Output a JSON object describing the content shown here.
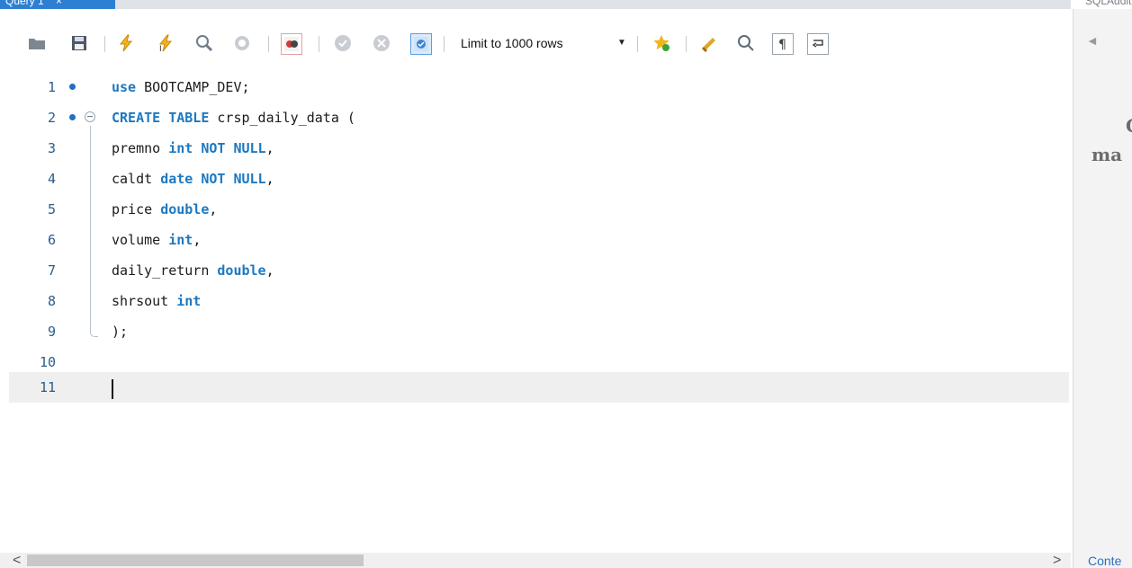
{
  "tab": {
    "title": "Query 1",
    "close": "×"
  },
  "right_tab": {
    "title": "SQLAdditions"
  },
  "toolbar": {
    "limit_label": "Limit to 1000 rows"
  },
  "editor": {
    "lines": [
      {
        "num": "1",
        "dot": true
      },
      {
        "num": "2",
        "dot": true,
        "fold": true
      },
      {
        "num": "3"
      },
      {
        "num": "4"
      },
      {
        "num": "5"
      },
      {
        "num": "6"
      },
      {
        "num": "7"
      },
      {
        "num": "8"
      },
      {
        "num": "9"
      },
      {
        "num": "10"
      },
      {
        "num": "11",
        "active": true
      }
    ],
    "code": {
      "l1_kw": "use",
      "l1_rest": " BOOTCAMP_DEV;",
      "l2_kw": "CREATE TABLE",
      "l2_rest": " crsp_daily_data (",
      "l3_id": "premno ",
      "l3_kw": "int NOT NULL",
      "l3_end": ",",
      "l4_id": "caldt ",
      "l4_kw": "date NOT NULL",
      "l4_end": ",",
      "l5_id": "price ",
      "l5_kw": "double",
      "l5_end": ",",
      "l6_id": "volume ",
      "l6_kw": "int",
      "l6_end": ",",
      "l7_id": "daily_return ",
      "l7_kw": "double",
      "l7_end": ",",
      "l8_id": "shrsout ",
      "l8_kw": "int",
      "l9": ");"
    }
  },
  "right_panel": {
    "back": "◄",
    "help_line1": "C",
    "help_line2": "ma",
    "context": "Conte"
  },
  "scroll": {
    "left": "<",
    "right": ">"
  }
}
